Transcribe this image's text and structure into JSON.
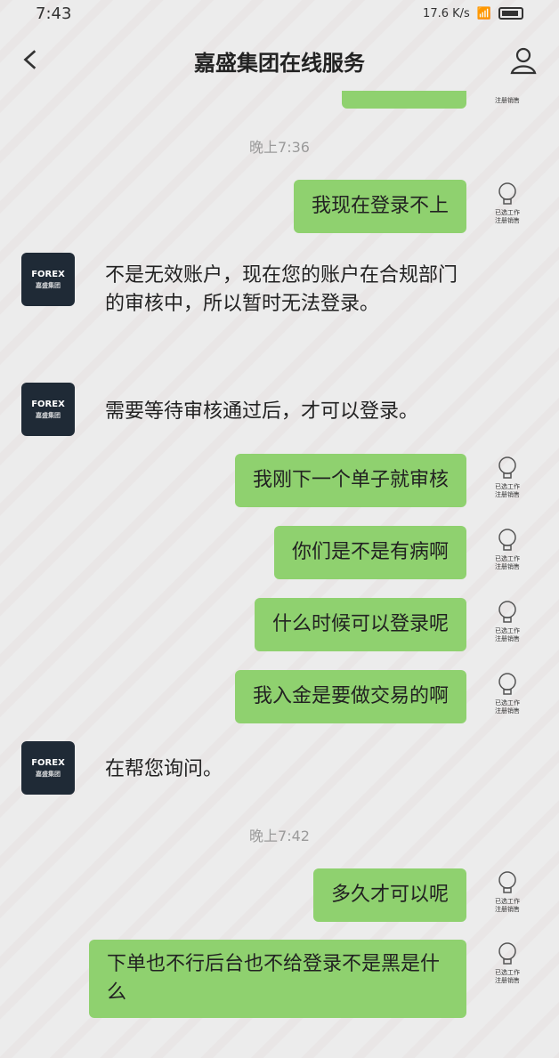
{
  "status": {
    "time": "7:43",
    "signal_text": "17.6 K/s",
    "battery_icon": "battery-icon"
  },
  "header": {
    "title": "嘉盛集团在线服务"
  },
  "top_avatar_label": "注册销售",
  "times": [
    "晚上7:36",
    "晚上7:42"
  ],
  "messages": [
    {
      "side": "right",
      "text": "我现在登录不上"
    },
    {
      "side": "left",
      "text": "不是无效账户，现在您的账户在合规部门的审核中，所以暂时无法登录。"
    },
    {
      "side": "left",
      "text": "需要等待审核通过后，才可以登录。"
    },
    {
      "side": "right",
      "text": "我刚下一个单子就审核"
    },
    {
      "side": "right",
      "text": "你们是不是有病啊"
    },
    {
      "side": "right",
      "text": "什么时候可以登录呢"
    },
    {
      "side": "right",
      "text": "我入金是要做交易的啊"
    },
    {
      "side": "left",
      "text": "在帮您询问。"
    },
    {
      "side": "right",
      "text": "多久才可以呢"
    },
    {
      "side": "right",
      "text": "下单也不行后台也不给登录不是黑是什么"
    }
  ],
  "left_avatar": {
    "main": "FOREX",
    "sub": "嘉盛集团"
  },
  "right_avatar": {
    "line1": "已选工作",
    "line2": "注册销售"
  },
  "colors": {
    "bubble": "#8fd16f",
    "background": "#ececec"
  }
}
